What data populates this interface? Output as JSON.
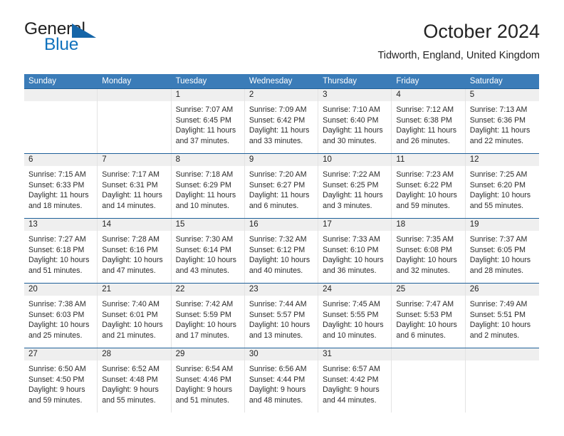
{
  "brand": {
    "word1": "General",
    "word2": "Blue",
    "triangle_color": "#1565a8",
    "blue_color": "#1072bd"
  },
  "header": {
    "title": "October 2024",
    "subtitle": "Tidworth, England, United Kingdom"
  },
  "theme": {
    "header_bg": "#3b7cb8",
    "row_border": "#1f6099",
    "daynum_bg": "#efefef"
  },
  "weekdays": [
    "Sunday",
    "Monday",
    "Tuesday",
    "Wednesday",
    "Thursday",
    "Friday",
    "Saturday"
  ],
  "weeks": [
    [
      {
        "day": "",
        "sunrise": "",
        "sunset": "",
        "daylight1": "",
        "daylight2": ""
      },
      {
        "day": "",
        "sunrise": "",
        "sunset": "",
        "daylight1": "",
        "daylight2": ""
      },
      {
        "day": "1",
        "sunrise": "Sunrise: 7:07 AM",
        "sunset": "Sunset: 6:45 PM",
        "daylight1": "Daylight: 11 hours",
        "daylight2": "and 37 minutes."
      },
      {
        "day": "2",
        "sunrise": "Sunrise: 7:09 AM",
        "sunset": "Sunset: 6:42 PM",
        "daylight1": "Daylight: 11 hours",
        "daylight2": "and 33 minutes."
      },
      {
        "day": "3",
        "sunrise": "Sunrise: 7:10 AM",
        "sunset": "Sunset: 6:40 PM",
        "daylight1": "Daylight: 11 hours",
        "daylight2": "and 30 minutes."
      },
      {
        "day": "4",
        "sunrise": "Sunrise: 7:12 AM",
        "sunset": "Sunset: 6:38 PM",
        "daylight1": "Daylight: 11 hours",
        "daylight2": "and 26 minutes."
      },
      {
        "day": "5",
        "sunrise": "Sunrise: 7:13 AM",
        "sunset": "Sunset: 6:36 PM",
        "daylight1": "Daylight: 11 hours",
        "daylight2": "and 22 minutes."
      }
    ],
    [
      {
        "day": "6",
        "sunrise": "Sunrise: 7:15 AM",
        "sunset": "Sunset: 6:33 PM",
        "daylight1": "Daylight: 11 hours",
        "daylight2": "and 18 minutes."
      },
      {
        "day": "7",
        "sunrise": "Sunrise: 7:17 AM",
        "sunset": "Sunset: 6:31 PM",
        "daylight1": "Daylight: 11 hours",
        "daylight2": "and 14 minutes."
      },
      {
        "day": "8",
        "sunrise": "Sunrise: 7:18 AM",
        "sunset": "Sunset: 6:29 PM",
        "daylight1": "Daylight: 11 hours",
        "daylight2": "and 10 minutes."
      },
      {
        "day": "9",
        "sunrise": "Sunrise: 7:20 AM",
        "sunset": "Sunset: 6:27 PM",
        "daylight1": "Daylight: 11 hours",
        "daylight2": "and 6 minutes."
      },
      {
        "day": "10",
        "sunrise": "Sunrise: 7:22 AM",
        "sunset": "Sunset: 6:25 PM",
        "daylight1": "Daylight: 11 hours",
        "daylight2": "and 3 minutes."
      },
      {
        "day": "11",
        "sunrise": "Sunrise: 7:23 AM",
        "sunset": "Sunset: 6:22 PM",
        "daylight1": "Daylight: 10 hours",
        "daylight2": "and 59 minutes."
      },
      {
        "day": "12",
        "sunrise": "Sunrise: 7:25 AM",
        "sunset": "Sunset: 6:20 PM",
        "daylight1": "Daylight: 10 hours",
        "daylight2": "and 55 minutes."
      }
    ],
    [
      {
        "day": "13",
        "sunrise": "Sunrise: 7:27 AM",
        "sunset": "Sunset: 6:18 PM",
        "daylight1": "Daylight: 10 hours",
        "daylight2": "and 51 minutes."
      },
      {
        "day": "14",
        "sunrise": "Sunrise: 7:28 AM",
        "sunset": "Sunset: 6:16 PM",
        "daylight1": "Daylight: 10 hours",
        "daylight2": "and 47 minutes."
      },
      {
        "day": "15",
        "sunrise": "Sunrise: 7:30 AM",
        "sunset": "Sunset: 6:14 PM",
        "daylight1": "Daylight: 10 hours",
        "daylight2": "and 43 minutes."
      },
      {
        "day": "16",
        "sunrise": "Sunrise: 7:32 AM",
        "sunset": "Sunset: 6:12 PM",
        "daylight1": "Daylight: 10 hours",
        "daylight2": "and 40 minutes."
      },
      {
        "day": "17",
        "sunrise": "Sunrise: 7:33 AM",
        "sunset": "Sunset: 6:10 PM",
        "daylight1": "Daylight: 10 hours",
        "daylight2": "and 36 minutes."
      },
      {
        "day": "18",
        "sunrise": "Sunrise: 7:35 AM",
        "sunset": "Sunset: 6:08 PM",
        "daylight1": "Daylight: 10 hours",
        "daylight2": "and 32 minutes."
      },
      {
        "day": "19",
        "sunrise": "Sunrise: 7:37 AM",
        "sunset": "Sunset: 6:05 PM",
        "daylight1": "Daylight: 10 hours",
        "daylight2": "and 28 minutes."
      }
    ],
    [
      {
        "day": "20",
        "sunrise": "Sunrise: 7:38 AM",
        "sunset": "Sunset: 6:03 PM",
        "daylight1": "Daylight: 10 hours",
        "daylight2": "and 25 minutes."
      },
      {
        "day": "21",
        "sunrise": "Sunrise: 7:40 AM",
        "sunset": "Sunset: 6:01 PM",
        "daylight1": "Daylight: 10 hours",
        "daylight2": "and 21 minutes."
      },
      {
        "day": "22",
        "sunrise": "Sunrise: 7:42 AM",
        "sunset": "Sunset: 5:59 PM",
        "daylight1": "Daylight: 10 hours",
        "daylight2": "and 17 minutes."
      },
      {
        "day": "23",
        "sunrise": "Sunrise: 7:44 AM",
        "sunset": "Sunset: 5:57 PM",
        "daylight1": "Daylight: 10 hours",
        "daylight2": "and 13 minutes."
      },
      {
        "day": "24",
        "sunrise": "Sunrise: 7:45 AM",
        "sunset": "Sunset: 5:55 PM",
        "daylight1": "Daylight: 10 hours",
        "daylight2": "and 10 minutes."
      },
      {
        "day": "25",
        "sunrise": "Sunrise: 7:47 AM",
        "sunset": "Sunset: 5:53 PM",
        "daylight1": "Daylight: 10 hours",
        "daylight2": "and 6 minutes."
      },
      {
        "day": "26",
        "sunrise": "Sunrise: 7:49 AM",
        "sunset": "Sunset: 5:51 PM",
        "daylight1": "Daylight: 10 hours",
        "daylight2": "and 2 minutes."
      }
    ],
    [
      {
        "day": "27",
        "sunrise": "Sunrise: 6:50 AM",
        "sunset": "Sunset: 4:50 PM",
        "daylight1": "Daylight: 9 hours",
        "daylight2": "and 59 minutes."
      },
      {
        "day": "28",
        "sunrise": "Sunrise: 6:52 AM",
        "sunset": "Sunset: 4:48 PM",
        "daylight1": "Daylight: 9 hours",
        "daylight2": "and 55 minutes."
      },
      {
        "day": "29",
        "sunrise": "Sunrise: 6:54 AM",
        "sunset": "Sunset: 4:46 PM",
        "daylight1": "Daylight: 9 hours",
        "daylight2": "and 51 minutes."
      },
      {
        "day": "30",
        "sunrise": "Sunrise: 6:56 AM",
        "sunset": "Sunset: 4:44 PM",
        "daylight1": "Daylight: 9 hours",
        "daylight2": "and 48 minutes."
      },
      {
        "day": "31",
        "sunrise": "Sunrise: 6:57 AM",
        "sunset": "Sunset: 4:42 PM",
        "daylight1": "Daylight: 9 hours",
        "daylight2": "and 44 minutes."
      },
      {
        "day": "",
        "sunrise": "",
        "sunset": "",
        "daylight1": "",
        "daylight2": ""
      },
      {
        "day": "",
        "sunrise": "",
        "sunset": "",
        "daylight1": "",
        "daylight2": ""
      }
    ]
  ]
}
